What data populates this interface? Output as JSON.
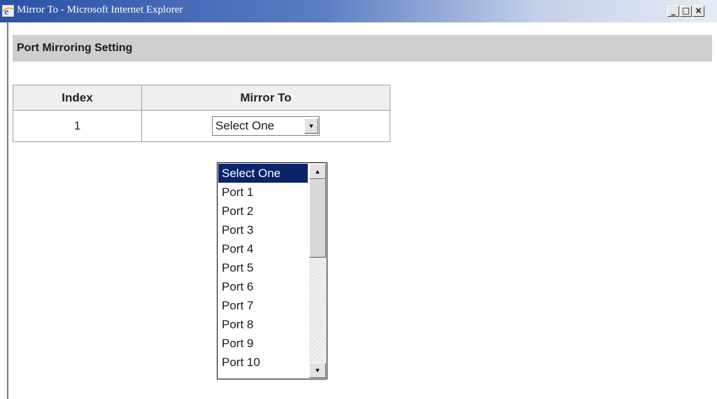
{
  "window": {
    "title": "Mirror To - Microsoft Internet Explorer",
    "minimize_glyph": "_",
    "maximize_glyph": "□",
    "close_glyph": "×"
  },
  "section": {
    "title": "Port Mirroring Setting"
  },
  "table": {
    "headers": [
      "Index",
      "Mirror To"
    ],
    "rows": [
      {
        "index": "1",
        "mirror_to": "Select One"
      }
    ]
  },
  "dropdown": {
    "options": [
      "Select One",
      "Port 1",
      "Port 2",
      "Port 3",
      "Port 4",
      "Port 5",
      "Port 6",
      "Port 7",
      "Port 8",
      "Port 9",
      "Port 10"
    ],
    "highlighted": "Select One",
    "scroll_up_glyph": "▲",
    "scroll_down_glyph": "▼",
    "arrow_glyph": "▼"
  },
  "colors": {
    "titlebar_start": "#2b52a8",
    "selection": "#0a246a",
    "section_bar": "#cfcfcf",
    "header_bg": "#efefef"
  }
}
